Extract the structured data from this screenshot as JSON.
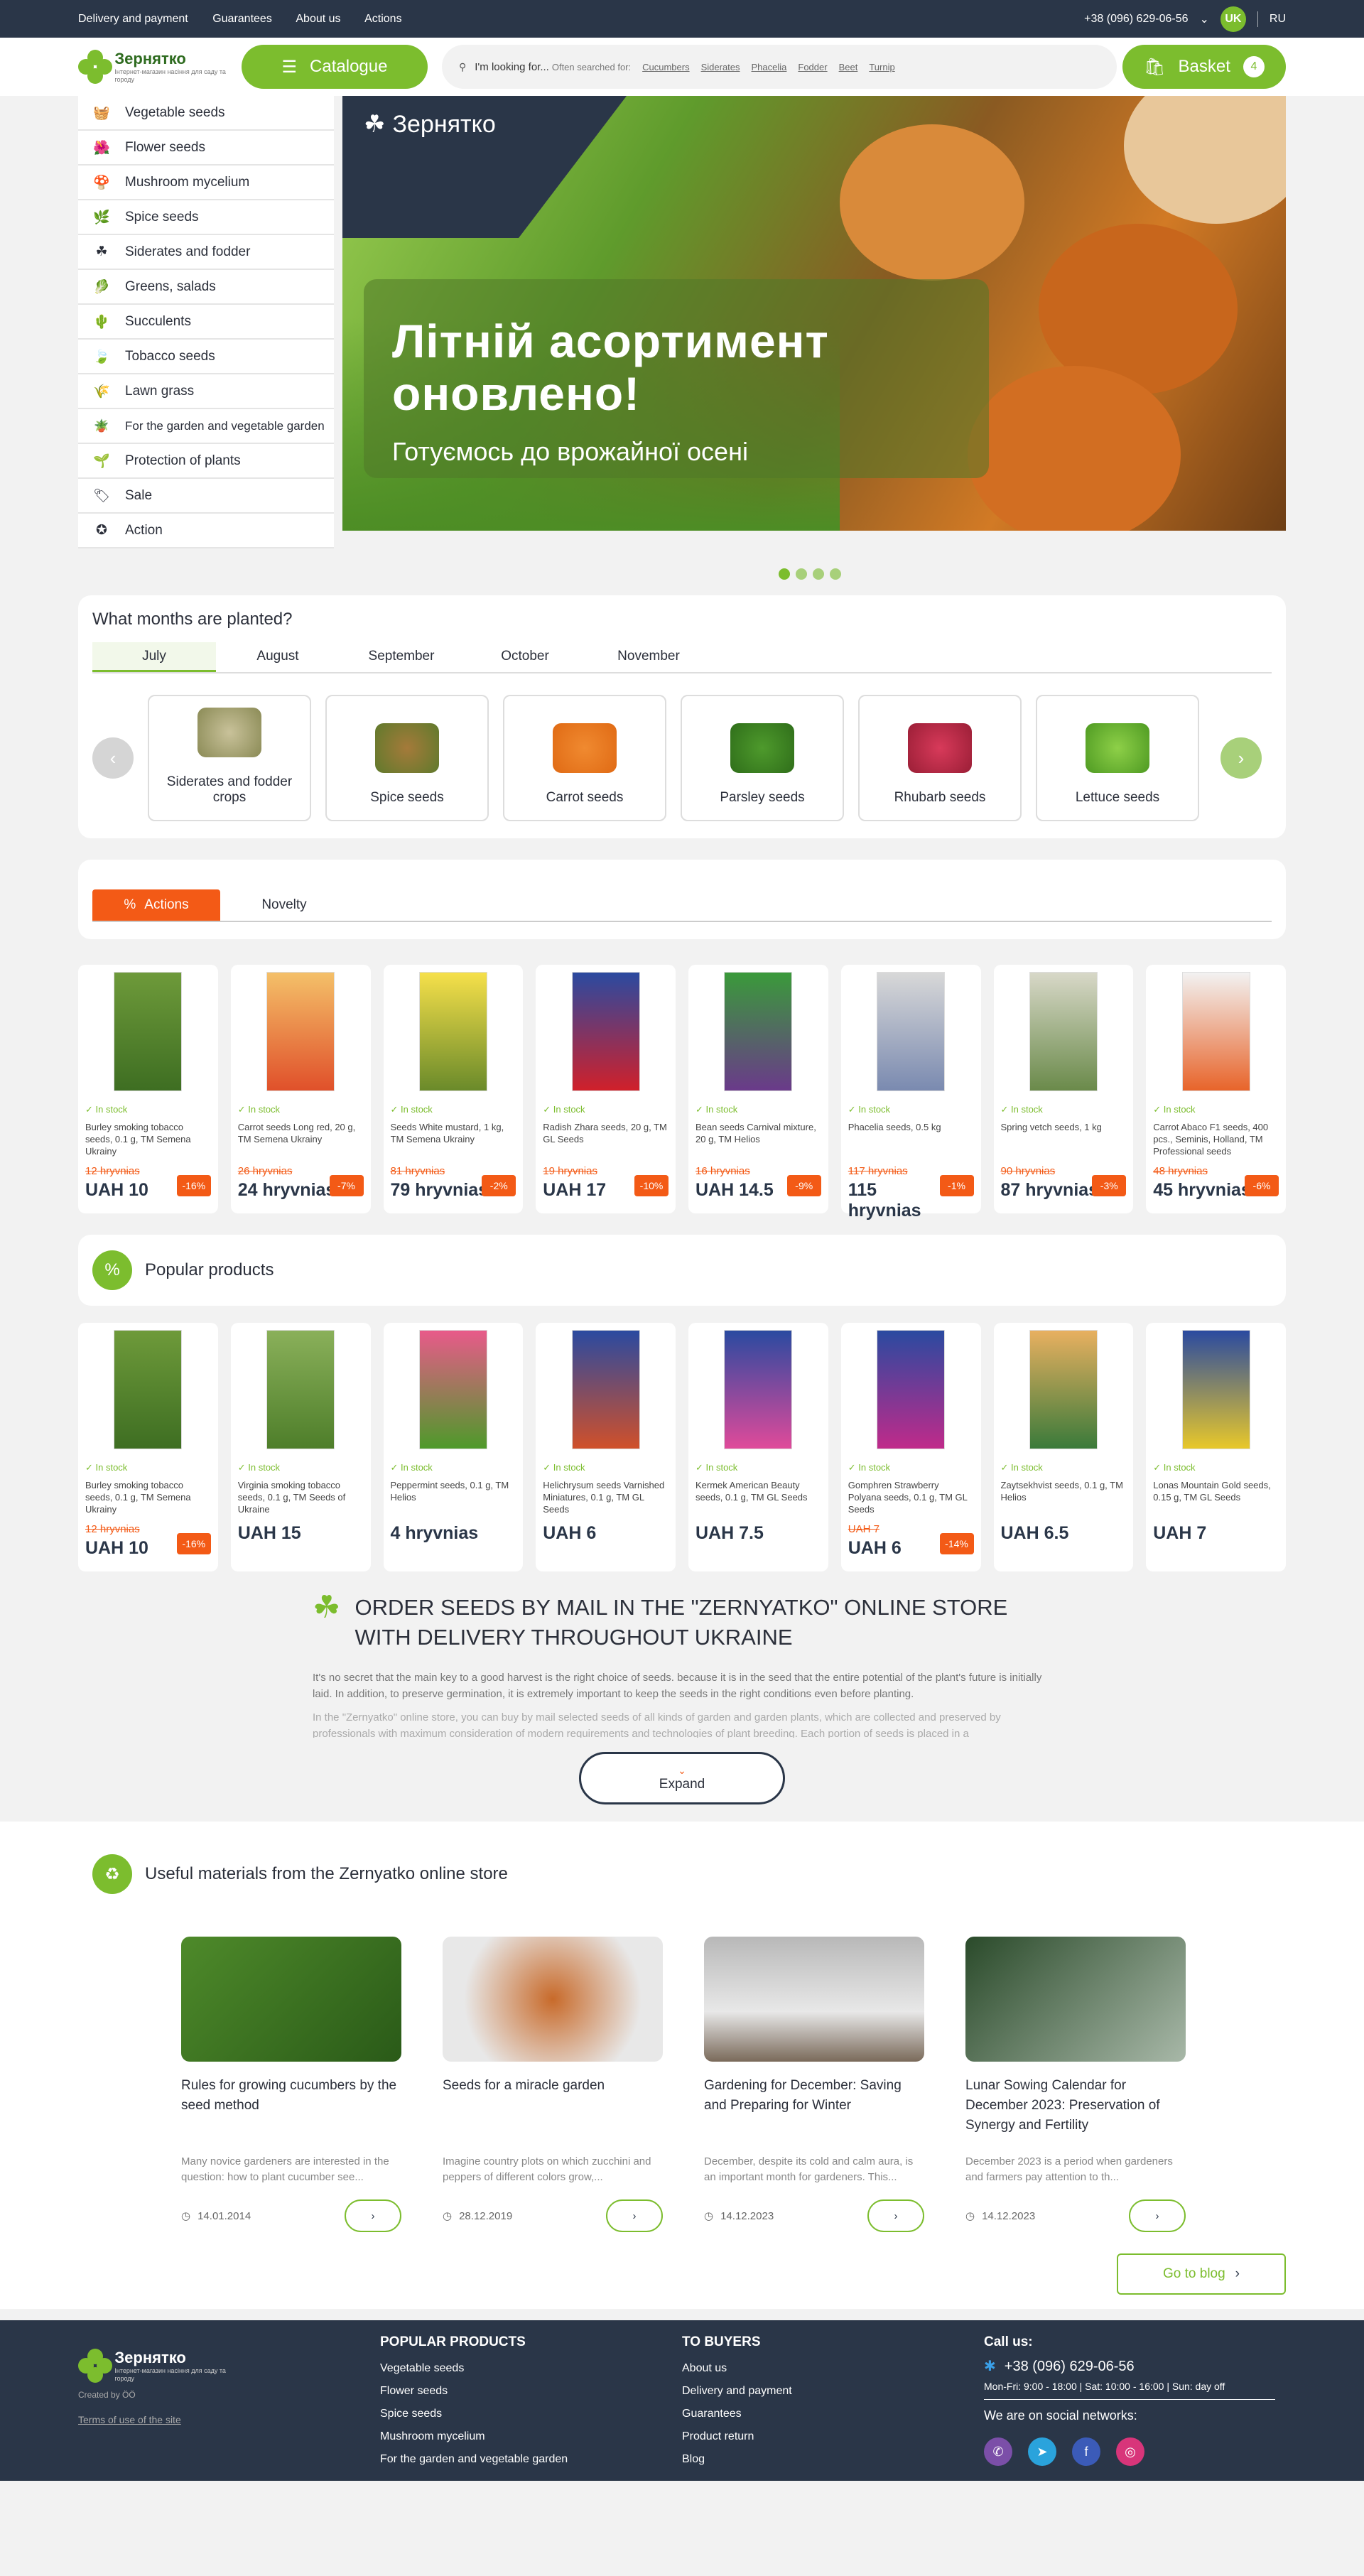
{
  "topbar": {
    "links": [
      "Delivery and payment",
      "Guarantees",
      "About us",
      "Actions"
    ],
    "phone": "+38 (096) 629-06-56",
    "lang_active": "UK",
    "lang_other": "RU"
  },
  "header": {
    "logo_text": "Зернятко",
    "logo_sub": "Інтернет-магазин насіння для саду та городу",
    "catalog_label": "Catalogue",
    "search_placeholder": "I'm looking for...",
    "often_label": "Often searched for:",
    "often_tags": [
      "Cucumbers",
      "Siderates",
      "Phacelia",
      "Fodder",
      "Beet",
      "Turnip"
    ],
    "basket_label": "Basket",
    "basket_count": "4"
  },
  "sidebar": {
    "items": [
      "Vegetable seeds",
      "Flower seeds",
      "Mushroom mycelium",
      "Spice seeds",
      "Siderates and fodder",
      "Greens, salads",
      "Succulents",
      "Tobacco seeds",
      "Lawn grass",
      "For the garden and vegetable garden",
      "Protection of plants",
      "Sale",
      "Action"
    ]
  },
  "banner": {
    "logo_text": "Зернятко",
    "headline": "Літній асортимент оновлено!",
    "subline": "Готуємось до врожайної осені",
    "dots_active": 1,
    "dots_total": 4
  },
  "months": {
    "title": "What months are planted?",
    "tabs": [
      "July",
      "August",
      "September",
      "October",
      "November"
    ],
    "active_tab": "July",
    "categories": [
      "Siderates and fodder crops",
      "Spice seeds",
      "Carrot seeds",
      "Parsley seeds",
      "Rhubarb seeds",
      "Lettuce seeds"
    ]
  },
  "actions": {
    "tabs": [
      "Actions",
      "Novelty"
    ],
    "stock_label": "In stock",
    "products": [
      {
        "name": "Burley smoking tobacco seeds, 0.1 g, TM Semena Ukrainy",
        "old": "12 hryvnias",
        "price": "UAH 10",
        "discount": "-16%"
      },
      {
        "name": "Carrot seeds Long red, 20 g, TM Semena Ukrainy",
        "old": "26 hryvnias",
        "price": "24 hryvnias",
        "discount": "-7%"
      },
      {
        "name": "Seeds White mustard, 1 kg, TM Semena Ukrainy",
        "old": "81 hryvnias",
        "price": "79 hryvnias",
        "discount": "-2%"
      },
      {
        "name": "Radish Zhara seeds, 20 g, TM GL Seeds",
        "old": "19 hryvnias",
        "price": "UAH 17",
        "discount": "-10%"
      },
      {
        "name": "Bean seeds Carnival mixture, 20 g, TM Helios",
        "old": "16 hryvnias",
        "price": "UAH 14.5",
        "discount": "-9%"
      },
      {
        "name": "Phacelia seeds, 0.5 kg",
        "old": "117 hryvnias",
        "price": "115 hryvnias",
        "discount": "-1%"
      },
      {
        "name": "Spring vetch seeds, 1 kg",
        "old": "90 hryvnias",
        "price": "87 hryvnias",
        "discount": "-3%"
      },
      {
        "name": "Carrot Abaco F1 seeds, 400 pcs., Seminis, Holland, TM Professional seeds",
        "old": "48 hryvnias",
        "price": "45 hryvnias",
        "discount": "-6%"
      }
    ]
  },
  "popular": {
    "title": "Popular products",
    "products": [
      {
        "name": "Burley smoking tobacco seeds, 0.1 g, TM Semena Ukrainy",
        "old": "12 hryvnias",
        "price": "UAH 10",
        "discount": "-16%"
      },
      {
        "name": "Virginia smoking tobacco seeds, 0.1 g, TM Seeds of Ukraine",
        "old": "",
        "price": "UAH 15",
        "discount": ""
      },
      {
        "name": "Peppermint seeds, 0.1 g, TM Helios",
        "old": "",
        "price": "4 hryvnias",
        "discount": ""
      },
      {
        "name": "Helichrysum seeds Varnished Miniatures, 0.1 g, TM GL Seeds",
        "old": "",
        "price": "UAH 6",
        "discount": ""
      },
      {
        "name": "Kermek American Beauty seeds, 0.1 g, TM GL Seeds",
        "old": "",
        "price": "UAH 7.5",
        "discount": ""
      },
      {
        "name": "Gomphren Strawberry Polyana seeds, 0.1 g, TM GL Seeds",
        "old": "UAH 7",
        "price": "UAH 6",
        "discount": "-14%"
      },
      {
        "name": "Zaytsekhvist seeds, 0.1 g, TM Helios",
        "old": "",
        "price": "UAH 6.5",
        "discount": ""
      },
      {
        "name": "Lonas Mountain Gold seeds, 0.15 g, TM GL Seeds",
        "old": "",
        "price": "UAH 7",
        "discount": ""
      }
    ]
  },
  "seo": {
    "title": "ORDER SEEDS BY MAIL IN THE \"ZERNYATKO\" ONLINE STORE WITH DELIVERY THROUGHOUT UKRAINE",
    "p1": "It's no secret that the main key to a good harvest is the right choice of seeds. because it is in the seed that the entire potential of the plant's future is initially laid. In addition, to preserve germination, it is extremely important to keep the seeds in the right conditions even before planting.",
    "p2": "In the \"Zernyatko\" online store, you can buy by mail selected seeds of all kinds of garden and garden plants, which are collected and preserved by professionals with maximum consideration of modern requirements and technologies of plant breeding. Each portion of seeds is placed in a",
    "expand_label": "Expand"
  },
  "blog": {
    "title": "Useful materials from the Zernyatko online store",
    "posts": [
      {
        "title": "Rules for growing cucumbers by the seed method",
        "desc": "Many novice gardeners are interested in the question: how to plant cucumber see...",
        "date": "14.01.2014"
      },
      {
        "title": "Seeds for a miracle garden",
        "desc": "Imagine country plots on which zucchini and peppers of different colors grow,...",
        "date": "28.12.2019"
      },
      {
        "title": "Gardening for December: Saving and Preparing for Winter",
        "desc": "December, despite its cold and calm aura, is an important month for gardeners. This...",
        "date": "14.12.2023"
      },
      {
        "title": "Lunar Sowing Calendar for December 2023: Preservation of Synergy and Fertility",
        "desc": "December 2023 is a period when gardeners and farmers pay attention to th...",
        "date": "14.12.2023"
      }
    ],
    "to_blog_label": "Go to blog"
  },
  "footer": {
    "logo_text": "Зернятко",
    "logo_sub": "Інтернет-магазин насіння для саду та городу",
    "created_by": "Created by ÖÖ",
    "terms": "Terms of use of the site",
    "popular_title": "POPULAR PRODUCTS",
    "popular_links": [
      "Vegetable seeds",
      "Flower seeds",
      "Spice seeds",
      "Mushroom mycelium",
      "For the garden and vegetable garden"
    ],
    "buyers_title": "TO BUYERS",
    "buyers_links": [
      "About us",
      "Delivery and payment",
      "Guarantees",
      "Product return",
      "Blog"
    ],
    "call_title": "Call us:",
    "phone": "+38 (096) 629-06-56",
    "hours": "Mon-Fri: 9:00 - 18:00 | Sat: 10:00 - 16:00 | Sun: day off",
    "social_title": "We are on social networks:"
  }
}
